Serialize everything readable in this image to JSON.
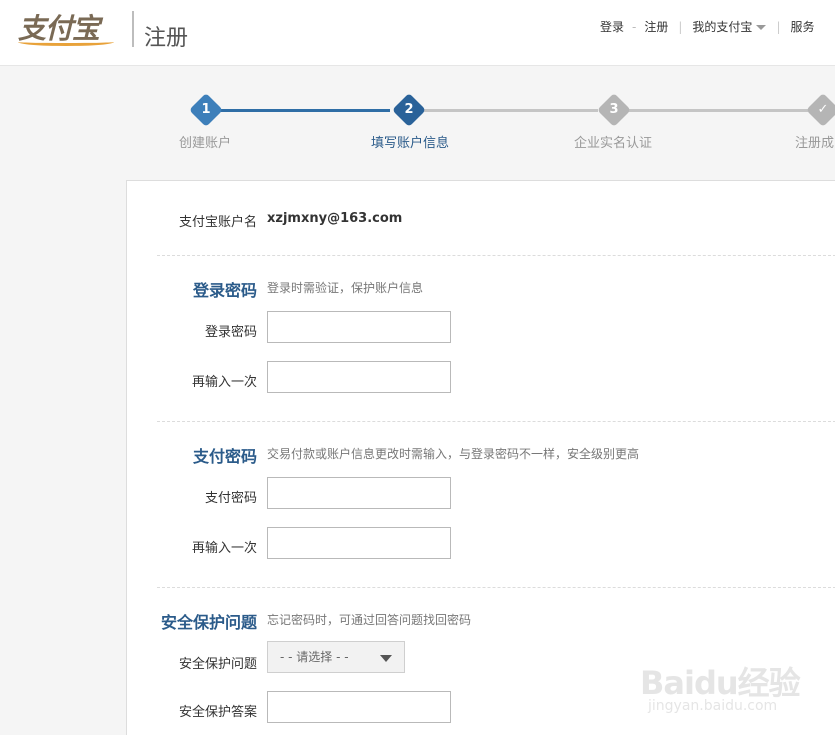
{
  "header": {
    "logo_text": "支付宝",
    "page_name": "注册",
    "nav": {
      "login": "登录",
      "register": "注册",
      "my_alipay": "我的支付宝",
      "service": "服务"
    }
  },
  "steps": [
    {
      "num": "1",
      "label": "创建账户",
      "state": "done"
    },
    {
      "num": "2",
      "label": "填写账户信息",
      "state": "current"
    },
    {
      "num": "3",
      "label": "企业实名认证",
      "state": "todo"
    },
    {
      "num": "✓",
      "label": "注册成",
      "state": "todo"
    }
  ],
  "colors": {
    "step_active": "#2f6ea6",
    "step_inactive": "#b5b5b5",
    "section_title": "#2b5b8a"
  },
  "form": {
    "account": {
      "label": "支付宝账户名",
      "value": "xzjmxny@163.com"
    },
    "login_pwd": {
      "title": "登录密码",
      "desc": "登录时需验证，保护账户信息",
      "field1_label": "登录密码",
      "field2_label": "再输入一次"
    },
    "pay_pwd": {
      "title": "支付密码",
      "desc": "交易付款或账户信息更改时需输入，与登录密码不一样，安全级别更高",
      "field1_label": "支付密码",
      "field2_label": "再输入一次"
    },
    "security": {
      "title": "安全保护问题",
      "desc": "忘记密码时，可通过回答问题找回密码",
      "question_label": "安全保护问题",
      "question_value": "- - 请选择 - -",
      "answer_label": "安全保护答案"
    }
  },
  "watermark": {
    "brand": "Baidu经验",
    "url": "jingyan.baidu.com"
  }
}
